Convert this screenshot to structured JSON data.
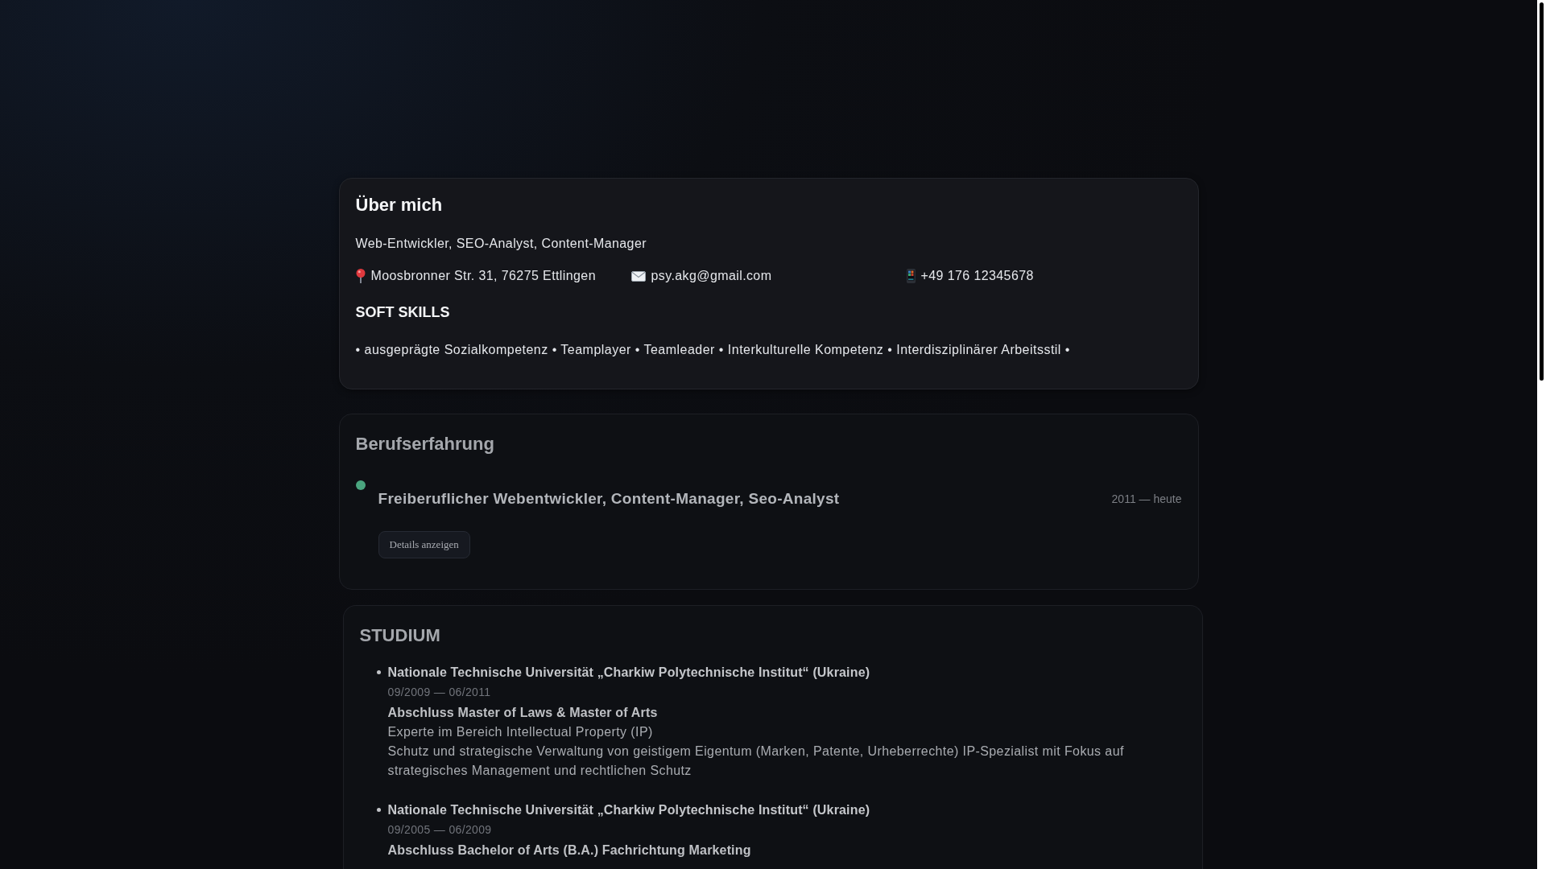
{
  "about": {
    "heading": "Über mich",
    "subtitle": "Web-Entwickler, SEO-Analyst, Content-Manager",
    "contacts": [
      {
        "kind": "address",
        "text": "Moosbronner Str. 31, 76275 Ettlingen"
      },
      {
        "kind": "email",
        "text": "psy.akg@gmail.com"
      },
      {
        "kind": "phone",
        "text": "+49 176 12345678"
      }
    ],
    "soft_skills": {
      "heading": "SOFT SKILLS",
      "text": "• ausgeprägte Sozialkompetenz • Teamplayer • Teamleader • Interkulturelle Kompetenz • Interdisziplinärer Arbeitsstil •"
    }
  },
  "experience": {
    "heading": "Berufserfahrung",
    "items": [
      {
        "title": "Freiberuflicher Webentwickler, Content-Manager, Seo-Analyst",
        "period": "2011 — heute",
        "button": "Details anzeigen"
      }
    ]
  },
  "education": {
    "heading": "STUDIUM",
    "items": [
      {
        "school": "Nationale Technische Universität „Charkiw Polytechnische Institut“ (Ukraine)",
        "period": "09/2009 — 06/2011",
        "degree": "Abschluss Master of Laws & Master of Arts",
        "lines": [
          "Experte im Bereich Intellectual Property (IP)",
          "Schutz und strategische Verwaltung von geistigem Eigentum (Marken, Patente, Urheberrechte) IP-Spezialist mit Fokus auf strategisches Management und rechtlichen Schutz"
        ]
      },
      {
        "school": "Nationale Technische Universität „Charkiw Polytechnische Institut“ (Ukraine)",
        "period": "09/2005 — 06/2009",
        "degree": "Abschluss Bachelor of Arts (B.A.) Fachrichtung Marketing"
      }
    ]
  }
}
